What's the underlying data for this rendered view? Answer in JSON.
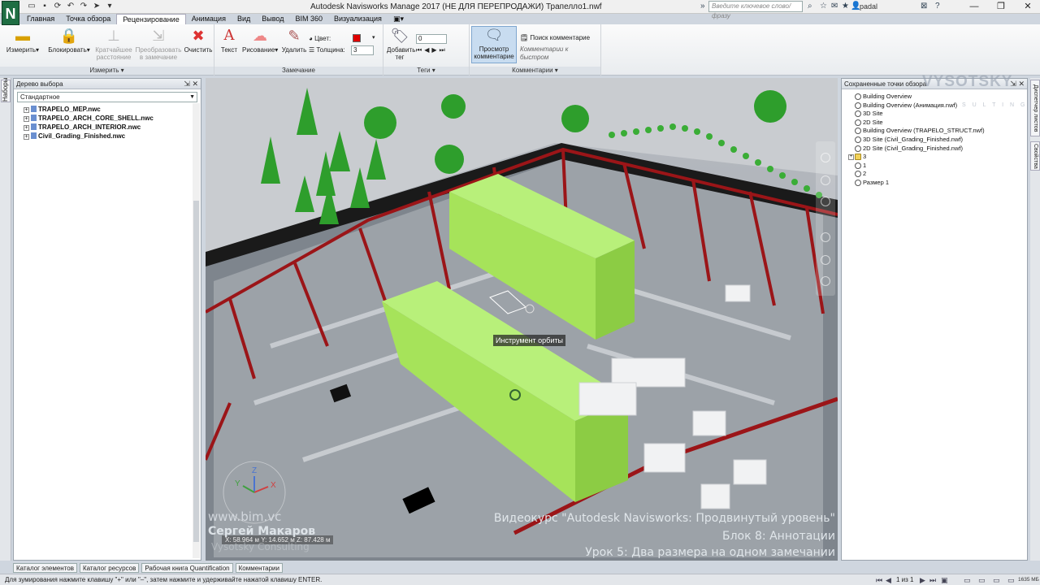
{
  "app": {
    "logo": "N",
    "window_title": "Autodesk Navisworks Manage 2017 (НЕ ДЛЯ ПЕРЕПРОДАЖИ)    Трапелло1.nwf",
    "search_placeholder": "Введите ключевое слово/фразу",
    "user": "padal"
  },
  "ribbon_tabs": [
    "Главная",
    "Точка обзора",
    "Рецензирование",
    "Анимация",
    "Вид",
    "Вывод",
    "BIM 360",
    "Визуализация"
  ],
  "ribbon": {
    "measure_group": {
      "label": "Измерить",
      "buttons": [
        "Измерить",
        "Блокировать",
        "Кратчайшее расстояние",
        "Преобразовать в замечание",
        "Очистить"
      ]
    },
    "redline_group": {
      "label": "Замечание",
      "text_btn": "Текст",
      "draw_btn": "Рисование",
      "delete_btn": "Удалить",
      "color_label": "Цвет:",
      "thickness_label": "Толщина:",
      "thickness_value": "3"
    },
    "tags_group": {
      "label": "Теги",
      "add_tag": "Добавить тег",
      "tag_value": "0"
    },
    "comments_group": {
      "label": "Комментарии",
      "view_comments": "Просмотр комментарие",
      "find_comments": "Поиск комментарие",
      "quick_find_placeholder": "Комментарии к быстром"
    }
  },
  "left_strip_tab": "Наборы",
  "selection_tree": {
    "title": "Дерево выбора",
    "combo_value": "Стандартное",
    "items": [
      "TRAPELO_MEP.nwc",
      "TRAPELO_ARCH_CORE_SHELL.nwc",
      "TRAPELO_ARCH_INTERIOR.nwc",
      "Civil_Grading_Finished.nwc"
    ]
  },
  "viewport": {
    "tooltip": "Инструмент орбиты",
    "coords": "X: 58.964 м  Y: 14.652 м  Z: 87.428 м",
    "axis_x": "X",
    "axis_y": "Y",
    "axis_z": "Z",
    "site_url": "www.bim.vc",
    "author_name": "Сергей Макаров",
    "author_company": "Vysotsky Consulting",
    "course_title": "Видеокурс \"Autodesk Navisworks: Продвинутый уровень\"",
    "course_block": "Блок 8: Аннотации",
    "course_lesson": "Урок 5: Два размера на одном замечании",
    "watermark": "VYSOTSKY",
    "watermark_sub": "S U L T I N G"
  },
  "saved_viewpoints": {
    "title": "Сохраненные точки обзора",
    "items": [
      {
        "label": "Building Overview",
        "type": "view"
      },
      {
        "label": "Building Overview (Анимация.nwf)",
        "type": "view"
      },
      {
        "label": "3D Site",
        "type": "view"
      },
      {
        "label": "2D Site",
        "type": "view"
      },
      {
        "label": "Building Overview (TRAPELO_STRUCT.nwf)",
        "type": "view"
      },
      {
        "label": "3D Site (Civil_Grading_Finished.nwf)",
        "type": "view"
      },
      {
        "label": "2D Site (Civil_Grading_Finished.nwf)",
        "type": "view"
      },
      {
        "label": "3",
        "type": "folder"
      },
      {
        "label": "1",
        "type": "view"
      },
      {
        "label": "2",
        "type": "view"
      },
      {
        "label": "Размер 1",
        "type": "view"
      }
    ]
  },
  "right_strip_tabs": [
    "Диспетчер листов",
    "Свойства"
  ],
  "bottom_tabs": [
    "Каталог элементов",
    "Каталог ресурсов",
    "Рабочая книга Quantification",
    "Комментарии"
  ],
  "status": {
    "text": "Для зумирования нажмите клавишу \"+\" или \"–\", затем нажмите и удерживайте нажатой клавишу ENTER.",
    "page": "1 из 1",
    "memory": "1635 МБ"
  },
  "colors": {
    "redline_color": "#e00000",
    "app_logo_bg": "#1f6e43",
    "highlight_green": "#a6e35a"
  }
}
